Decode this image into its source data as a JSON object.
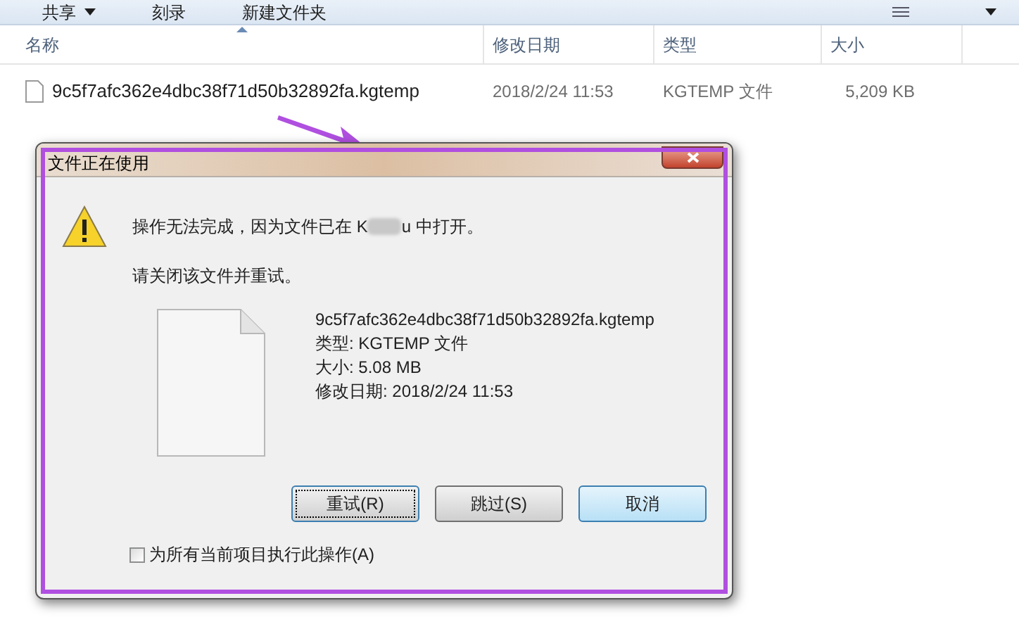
{
  "toolbar": {
    "items": [
      {
        "label": "共享",
        "has_menu": true
      },
      {
        "label": "刻录",
        "has_menu": false
      },
      {
        "label": "新建文件夹",
        "has_menu": false
      }
    ]
  },
  "file_list": {
    "columns": [
      {
        "label": "名称",
        "sorted": true
      },
      {
        "label": "修改日期",
        "sorted": false
      },
      {
        "label": "类型",
        "sorted": false
      },
      {
        "label": "大小",
        "sorted": false
      }
    ],
    "rows": [
      {
        "name": "9c5f7afc362e4dbc38f71d50b32892fa.kgtemp",
        "date": "2018/2/24 11:53",
        "type": "KGTEMP 文件",
        "size": "5,209 KB"
      }
    ]
  },
  "dialog": {
    "title": "文件正在使用",
    "message_before": "操作无法完成，因为文件已在 K",
    "message_redacted": true,
    "message_after": "u 中打开。",
    "instruction": "请关闭该文件并重试。",
    "file_details": [
      "9c5f7afc362e4dbc38f71d50b32892fa.kgtemp",
      "类型: KGTEMP 文件",
      "大小: 5.08 MB",
      "修改日期: 2018/2/24 11:53"
    ],
    "buttons": [
      {
        "label": "重试(R)",
        "focused": true,
        "default": false
      },
      {
        "label": "跳过(S)",
        "focused": false,
        "default": false
      },
      {
        "label": "取消",
        "focused": false,
        "default": true
      }
    ],
    "apply_all": {
      "label": "为所有当前项目执行此操作(A)",
      "checked": false
    }
  }
}
